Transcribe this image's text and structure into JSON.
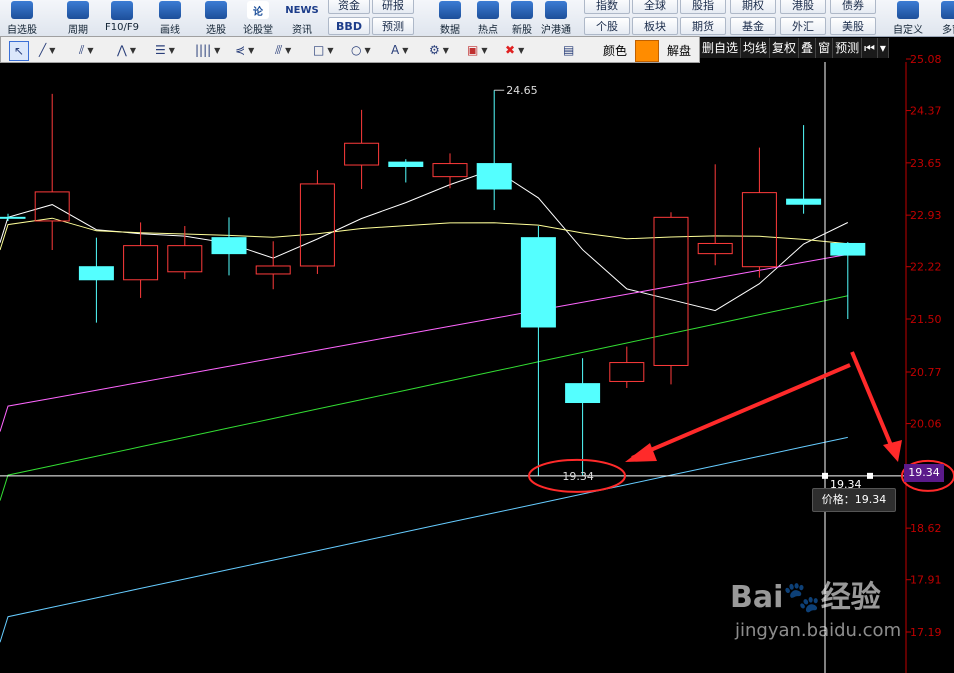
{
  "toolbar": {
    "buttons": [
      {
        "label": "自选股",
        "x": 0
      },
      {
        "label": "周期",
        "x": 56
      },
      {
        "label": "F10/F9",
        "x": 100
      },
      {
        "label": "画线",
        "x": 148
      },
      {
        "label": "选股",
        "x": 194
      },
      {
        "label": "论股堂",
        "x": 236
      },
      {
        "label": "资讯",
        "x": 280
      },
      {
        "label": "数据",
        "x": 428
      },
      {
        "label": "热点",
        "x": 466
      },
      {
        "label": "新股",
        "x": 500
      },
      {
        "label": "沪港通",
        "x": 534
      },
      {
        "label": "自定义",
        "x": 886
      },
      {
        "label": "多窗",
        "x": 930
      }
    ],
    "small_buttons": [
      {
        "label": "资金"
      },
      {
        "label": "研报"
      },
      {
        "label": "BBD"
      },
      {
        "label": "预测"
      },
      {
        "label": "指数"
      },
      {
        "label": "全球"
      },
      {
        "label": "股指"
      },
      {
        "label": "期权"
      },
      {
        "label": "港股"
      },
      {
        "label": "债券"
      },
      {
        "label": "个股"
      },
      {
        "label": "板块"
      },
      {
        "label": "期货"
      },
      {
        "label": "基金"
      },
      {
        "label": "外汇"
      },
      {
        "label": "美股"
      }
    ],
    "news_label": "NEWS",
    "lun_label": "论"
  },
  "draw_toolbar": {
    "color_label": "颜色",
    "unlock_label": "解盘",
    "color": "#ff8c00"
  },
  "quick_menu": [
    "删自选",
    "均线",
    "复权",
    "叠",
    "窗",
    "预测"
  ],
  "chart_data": {
    "type": "candlestick",
    "y_ticks": [
      "25.08",
      "24.37",
      "23.65",
      "22.93",
      "22.22",
      "21.50",
      "20.77",
      "20.06",
      "19.34",
      "18.62",
      "17.91",
      "17.19"
    ],
    "ylim": [
      16.76,
      25.08
    ],
    "candles": [
      {
        "o": 22.9,
        "c": 22.9,
        "h": 22.95,
        "l": 22.85,
        "dir": "down"
      },
      {
        "o": 22.85,
        "c": 23.25,
        "h": 24.6,
        "l": 22.45,
        "dir": "up"
      },
      {
        "o": 22.22,
        "c": 22.04,
        "h": 22.62,
        "l": 21.45,
        "dir": "down"
      },
      {
        "o": 22.04,
        "c": 22.51,
        "h": 22.83,
        "l": 21.79,
        "dir": "up"
      },
      {
        "o": 22.15,
        "c": 22.51,
        "h": 22.78,
        "l": 22.05,
        "dir": "up"
      },
      {
        "o": 22.62,
        "c": 22.4,
        "h": 22.9,
        "l": 22.1,
        "dir": "down"
      },
      {
        "o": 22.12,
        "c": 22.23,
        "h": 22.57,
        "l": 21.91,
        "dir": "up"
      },
      {
        "o": 22.23,
        "c": 23.36,
        "h": 23.55,
        "l": 22.12,
        "dir": "up"
      },
      {
        "o": 23.62,
        "c": 23.92,
        "h": 24.38,
        "l": 23.29,
        "dir": "up"
      },
      {
        "o": 23.66,
        "c": 23.6,
        "h": 23.7,
        "l": 23.38,
        "dir": "down"
      },
      {
        "o": 23.46,
        "c": 23.64,
        "h": 23.78,
        "l": 23.3,
        "dir": "up"
      },
      {
        "o": 23.64,
        "c": 23.29,
        "h": 24.65,
        "l": 23.0,
        "dir": "down"
      },
      {
        "o": 22.62,
        "c": 21.39,
        "h": 22.78,
        "l": 19.34,
        "dir": "down"
      },
      {
        "o": 20.61,
        "c": 20.35,
        "h": 20.96,
        "l": 19.34,
        "dir": "down"
      },
      {
        "o": 20.64,
        "c": 20.9,
        "h": 21.12,
        "l": 20.55,
        "dir": "up"
      },
      {
        "o": 20.86,
        "c": 22.9,
        "h": 22.97,
        "l": 20.6,
        "dir": "up"
      },
      {
        "o": 22.4,
        "c": 22.54,
        "h": 23.63,
        "l": 22.24,
        "dir": "up"
      },
      {
        "o": 22.22,
        "c": 23.24,
        "h": 23.86,
        "l": 22.07,
        "dir": "up"
      },
      {
        "o": 23.15,
        "c": 23.08,
        "h": 24.17,
        "l": 22.95,
        "dir": "down"
      },
      {
        "o": 22.54,
        "c": 22.38,
        "h": 22.56,
        "l": 21.5,
        "dir": "down"
      }
    ],
    "annotations": {
      "high": "24.65",
      "low": "19.34",
      "price_label": "价格：19.34",
      "current_price": "19.34",
      "crosshair_value": "19.34"
    },
    "colors": {
      "up": "#ff3b3b",
      "down": "#54ffff",
      "axis": "#c00000",
      "ma5": "#ffffff",
      "ma10": "#ffff99",
      "ma20": "#ff66ff",
      "ma30": "#33dd33",
      "ma60": "#66ccff",
      "arrow": "#ff2a2a"
    }
  },
  "watermark": {
    "brand": "Bai",
    "site": "jingyan.baidu.com",
    "brand_cn": "经验"
  }
}
